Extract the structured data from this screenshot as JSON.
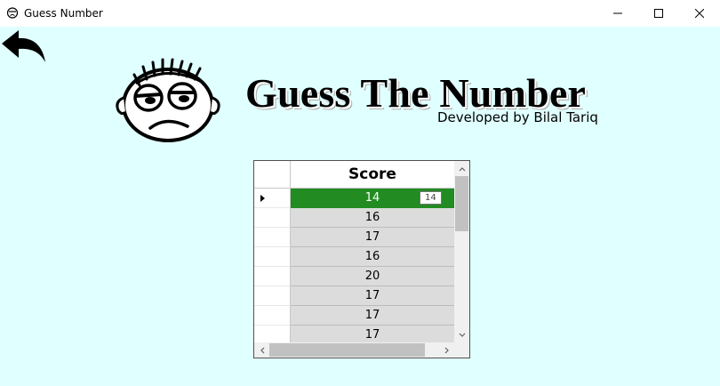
{
  "window": {
    "title": "Guess Number"
  },
  "header": {
    "title": "Guess The Number",
    "subtitle": "Developed by Bilal Tariq"
  },
  "grid": {
    "column_header": "Score",
    "rows": [
      "14",
      "16",
      "17",
      "16",
      "20",
      "17",
      "17",
      "17"
    ],
    "selected_row_index": 0,
    "tooltip": "14"
  },
  "colors": {
    "background": "#e0ffff",
    "selected_row": "#228b22",
    "cell_background": "#dcdcdc"
  }
}
